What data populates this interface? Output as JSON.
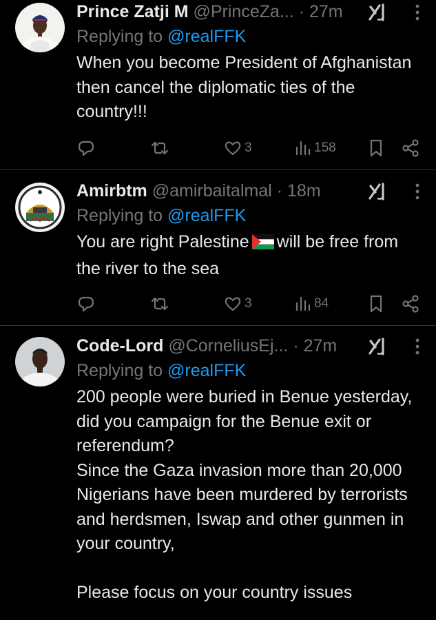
{
  "colors": {
    "background": "#000000",
    "text": "#e7e9ea",
    "muted": "#71767b",
    "link": "#1d9bf0",
    "divider": "#2f3336"
  },
  "tweets": [
    {
      "display_name": "Prince Zatji M",
      "handle": "@PrinceZa...",
      "time": "· 27m",
      "replying_label": "Replying to",
      "replying_to": "@realFFK",
      "text": "When you become President of Afghanistan then cancel the diplomatic ties of the country!!!",
      "likes": "3",
      "views": "158",
      "avatar_icon": "avatar-person-white-agbada"
    },
    {
      "display_name": "Amirbtm",
      "handle": "@amirbaitalmal",
      "time": "· 18m",
      "replying_label": "Replying to",
      "replying_to": "@realFFK",
      "text_before_flag": "You are right Palestine",
      "flag_icon": "palestine-flag-icon",
      "text_after_flag": "will be free from the river to the sea",
      "likes": "3",
      "views": "84",
      "avatar_icon": "avatar-al-aqsa-emblem"
    },
    {
      "display_name": "Code-Lord",
      "handle": "@CorneliusEj...",
      "time": "· 27m",
      "replying_label": "Replying to",
      "replying_to": "@realFFK",
      "text": "200 people were buried in Benue yesterday, did you campaign for the Benue exit or  referendum?\nSince the Gaza invasion more than 20,000 Nigerians have been murdered by terrorists and herdsmen, Iswap and other gunmen in your country,\n\nPlease focus on your country issues",
      "avatar_icon": "avatar-person-white-shirt"
    }
  ],
  "icons": {
    "reply": "reply-icon",
    "retweet": "retweet-icon",
    "like": "heart-icon",
    "views": "views-icon",
    "bookmark": "bookmark-icon",
    "share": "share-icon",
    "grok": "grok-icon",
    "more": "more-icon"
  }
}
